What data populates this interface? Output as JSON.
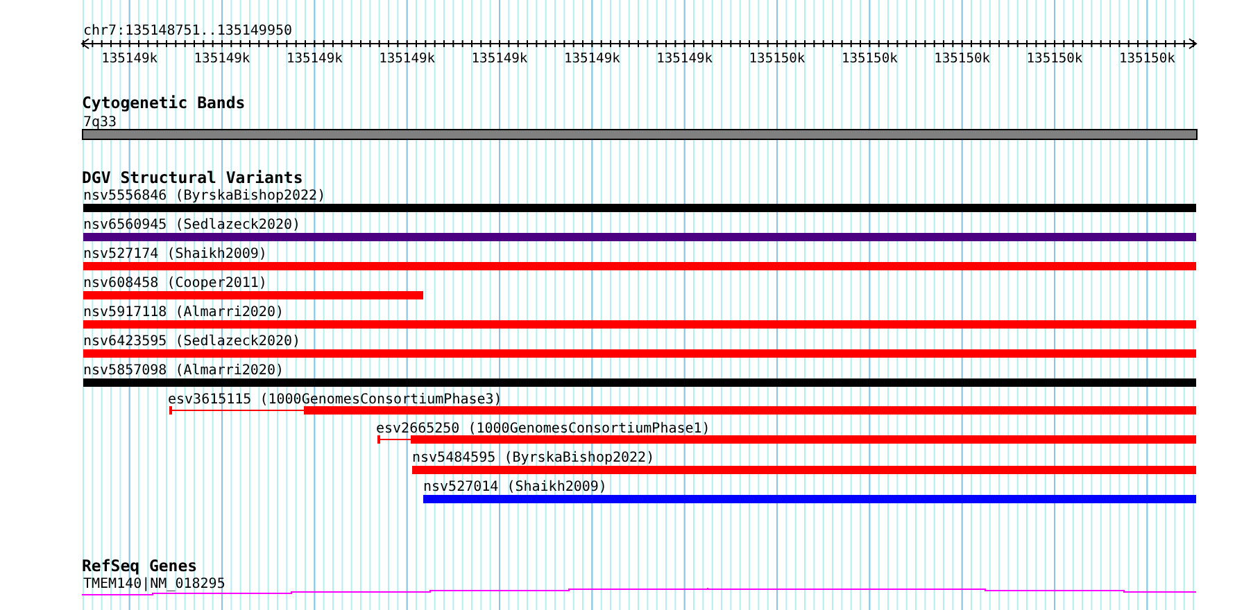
{
  "ruler": {
    "location": "chr7:135148751..135149950",
    "ticks": [
      "135149k",
      "135149k",
      "135149k",
      "135149k",
      "135149k",
      "135149k",
      "135149k",
      "135150k",
      "135150k",
      "135150k",
      "135150k",
      "135150k"
    ]
  },
  "cytogenetic_bands": {
    "title": "Cytogenetic Bands",
    "band": "7q33"
  },
  "dgv_structural_variants": {
    "title": "DGV Structural Variants",
    "features": [
      {
        "label": "nsv5556846 (ByrskaBishop2022)",
        "color": "#000000",
        "kind": "solid"
      },
      {
        "label": "nsv6560945 (Sedlazeck2020)",
        "color": "#4b0082",
        "kind": "solid"
      },
      {
        "label": "nsv527174 (Shaikh2009)",
        "color": "#ff0000",
        "kind": "solid"
      },
      {
        "label": "nsv608458 (Cooper2011)",
        "color": "#ff0000",
        "kind": "solid"
      },
      {
        "label": "nsv5917118 (Almarri2020)",
        "color": "#ff0000",
        "kind": "solid"
      },
      {
        "label": "nsv6423595 (Sedlazeck2020)",
        "color": "#ff0000",
        "kind": "solid"
      },
      {
        "label": "nsv5857098 (Almarri2020)",
        "color": "#000000",
        "kind": "solid"
      },
      {
        "label": "esv3615115 (1000GenomesConsortiumPhase3)",
        "color": "#ff0000",
        "kind": "split"
      },
      {
        "label": "esv2665250 (1000GenomesConsortiumPhase1)",
        "color": "#ff0000",
        "kind": "split"
      },
      {
        "label": "nsv5484595 (ByrskaBishop2022)",
        "color": "#ff0000",
        "kind": "solid"
      },
      {
        "label": "nsv527014 (Shaikh2009)",
        "color": "#0000ff",
        "kind": "solid"
      }
    ]
  },
  "refseq_genes": {
    "title": "RefSeq Genes",
    "genes": [
      {
        "label": "TMEM140|NM_018295"
      }
    ]
  }
}
